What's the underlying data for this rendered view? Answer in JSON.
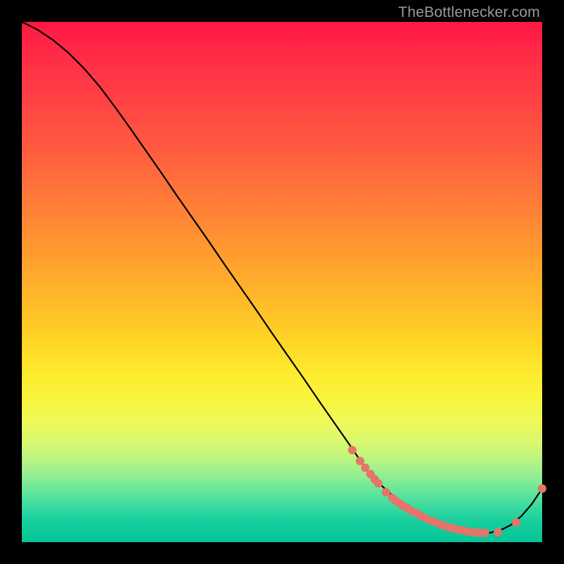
{
  "attribution": "TheBottlenecker.com",
  "colors": {
    "curve": "#000000",
    "marker": "#e5746b",
    "background_top": "#ff1744",
    "background_bottom": "#06c498"
  },
  "chart_data": {
    "type": "line",
    "title": "",
    "xlabel": "",
    "ylabel": "",
    "xlim": [
      0,
      100
    ],
    "ylim": [
      0,
      100
    ],
    "series": [
      {
        "name": "curve",
        "x": [
          0,
          3,
          6,
          9,
          12,
          15,
          18,
          21,
          24,
          27,
          30,
          33,
          36,
          39,
          42,
          45,
          48,
          51,
          54,
          57,
          60,
          63,
          66,
          67.5,
          69,
          70.5,
          72,
          74,
          76,
          78,
          80,
          82,
          84,
          86,
          88,
          90,
          92,
          94,
          96,
          98,
          100
        ],
        "values": [
          100,
          98.5,
          96.5,
          94,
          91,
          87.5,
          83.5,
          79.3,
          75,
          70.7,
          66.3,
          62,
          57.7,
          53.3,
          49,
          44.7,
          40.3,
          36,
          31.7,
          27.3,
          23,
          18.7,
          14.3,
          12.5,
          11,
          9.6,
          8.3,
          6.7,
          5.3,
          4.2,
          3.3,
          2.6,
          2.1,
          1.8,
          1.7,
          1.8,
          2.3,
          3.3,
          5,
          7.3,
          10.3
        ]
      }
    ],
    "markers": {
      "name": "highlighted-points",
      "x": [
        63.5,
        65,
        66,
        67,
        67.8,
        68.5,
        70,
        71.2,
        71.8,
        72.5,
        73.2,
        74,
        74.8,
        75.5,
        76.3,
        77,
        78,
        79,
        80,
        81,
        82,
        83,
        84,
        85,
        86,
        87,
        88,
        89,
        91.5,
        95,
        100
      ],
      "values": [
        17.7,
        15.6,
        14.3,
        13.1,
        12.1,
        11.3,
        9.6,
        8.5,
        8.0,
        7.5,
        7.0,
        6.6,
        6.1,
        5.7,
        5.3,
        4.9,
        4.4,
        4.0,
        3.6,
        3.2,
        2.9,
        2.6,
        2.4,
        2.2,
        2.0,
        1.9,
        1.8,
        1.8,
        1.9,
        3.8,
        10.3
      ]
    }
  }
}
